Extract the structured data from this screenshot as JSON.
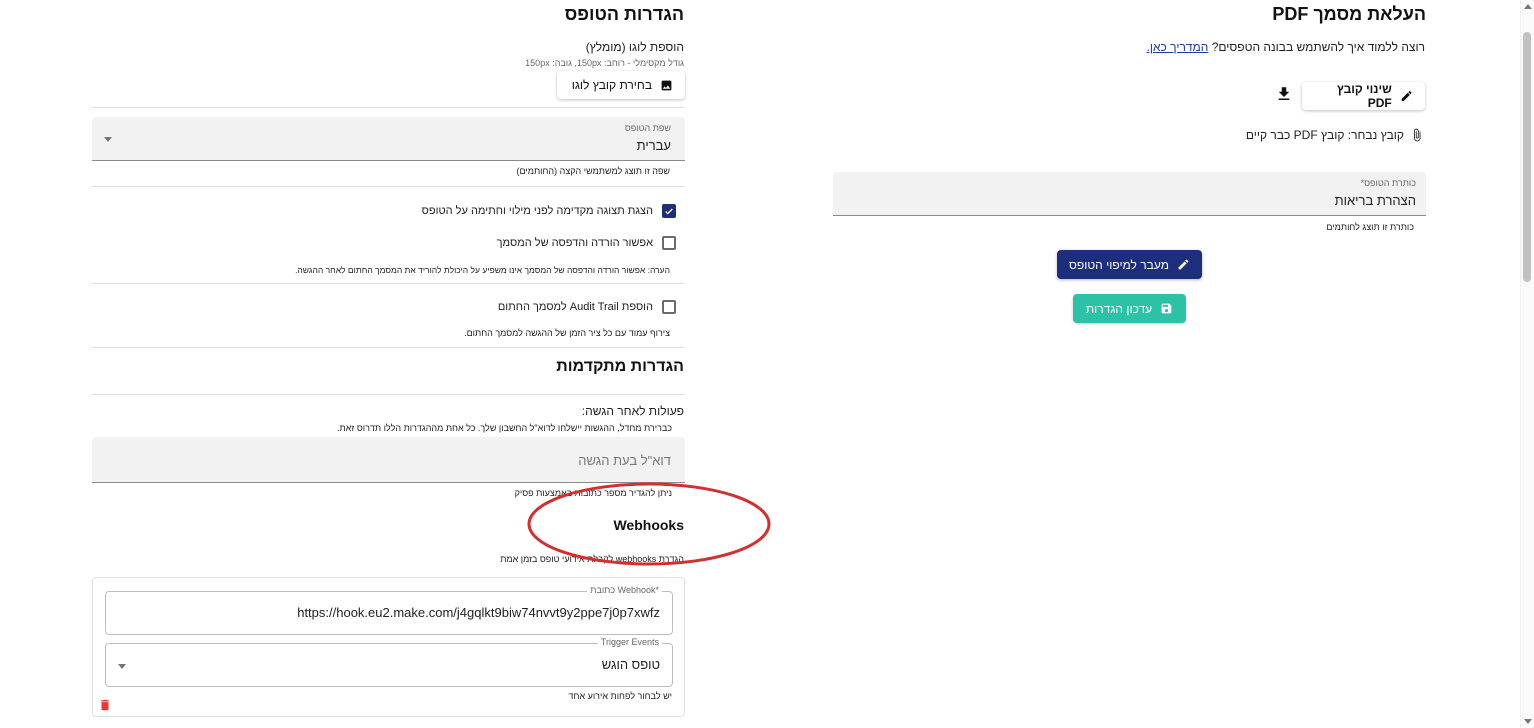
{
  "upload": {
    "title": "העלאת מסמך PDF",
    "guide_prefix": "רוצה ללמוד איך להשתמש בבונה הטפסים?",
    "guide_link": "המדריך כאן.",
    "change_file_button": "שינוי קובץ PDF",
    "selected_file_text": "קובץ נבחר: קובץ PDF כבר קיים",
    "form_title_label": "כותרת הטופס*",
    "form_title_value": "הצהרת בריאות",
    "form_title_helper": "כותרת זו תוצג לחותמים",
    "mapping_button": "מעבר למיפוי הטופס",
    "update_settings_button": "עדכון הגדרות"
  },
  "settings": {
    "title": "הגדרות הטופס",
    "logo_label": "הוספת לוגו (מומלץ)",
    "logo_size_hint": "גודל מקסימלי - רוחב: 150px, גובה: 150px",
    "choose_logo_button": "בחירת קובץ לוגו",
    "language_label": "שפת הטופס",
    "language_value": "עברית",
    "language_helper": "שפה זו תוצג למשתמשי הקצה (החותמים)",
    "preview_checkbox": "הצגת תצוגה מקדימה לפני מילוי וחתימה על הטופס",
    "preview_checked": true,
    "download_checkbox": "אפשור הורדה והדפסה של המסמך",
    "download_checked": false,
    "download_note": "הערה: אפשור הורדה והדפסה של המסמך אינו משפיע על היכולת להוריד את המסמך החתום לאחר ההגשה.",
    "audit_checkbox": "הוספת Audit Trail למסמך החתום",
    "audit_checked": false,
    "audit_helper": "צירוף עמוד עם כל ציר הזמן של ההגשה למסמך החתום."
  },
  "advanced": {
    "title": "הגדרות מתקדמות",
    "post_submit_label": "פעולות לאחר הגשה:",
    "post_submit_hint": "כברירת מחדל, ההגשות יישלחו לדוא\"ל החשבון שלך. כל אחת מההגדרות הללו תדרוס זאת.",
    "email_placeholder": "דוא\"ל בעת הגשה",
    "email_helper": "ניתן להגדיר מספר כתובות באמצעות פסיק",
    "webhooks_title": "Webhooks",
    "webhooks_hint": "הגדרת webhooks לקבלת אירועי טופס בזמן אמת",
    "webhook_url_label": "כתובת Webhook*",
    "webhook_url_value": "https://hook.eu2.make.com/j4gqlkt9biw74nvvt9y2ppe7j0p7xwfz",
    "trigger_events_label": "Trigger Events",
    "trigger_events_value": "טופס הוגש",
    "trigger_events_helper": "יש לבחור לפחות אירוע אחד"
  },
  "colors": {
    "primary": "#1c2e7c",
    "teal": "#2bc2a6",
    "delete": "#e53935",
    "annotation_circle": "#d32f2f"
  },
  "icons": [
    "pencil-icon",
    "download-icon",
    "paperclip-icon",
    "save-icon",
    "image-icon",
    "checkmark-icon",
    "trash-icon",
    "dropdown-caret-icon"
  ]
}
